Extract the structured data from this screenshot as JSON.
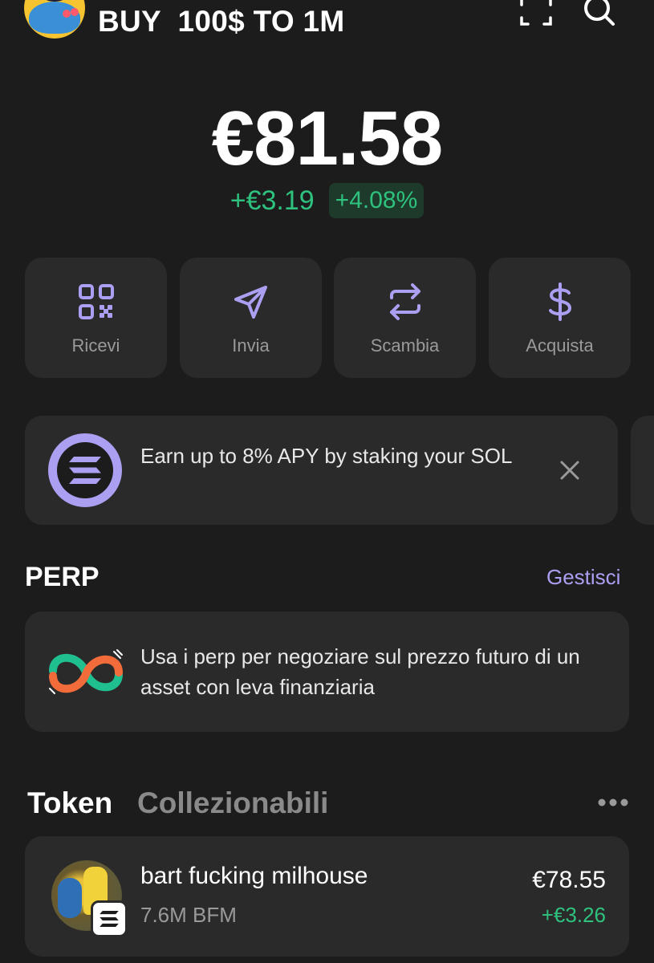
{
  "header": {
    "wallet_name": "BUY  100$ TO 1M",
    "icons": [
      "avatar",
      "scan-icon",
      "search-icon"
    ]
  },
  "balance": {
    "total": "€81.58",
    "change_abs": "+€3.19",
    "change_pct": "+4.08%"
  },
  "actions": [
    {
      "label": "Ricevi",
      "icon": "qr-code-icon"
    },
    {
      "label": "Invia",
      "icon": "send-icon"
    },
    {
      "label": "Scambia",
      "icon": "swap-icon"
    },
    {
      "label": "Acquista",
      "icon": "dollar-icon"
    }
  ],
  "banner": {
    "text": "Earn up to 8% APY by staking your SOL",
    "icon": "solana-icon"
  },
  "perp": {
    "title": "PERP",
    "manage": "Gestisci",
    "text": "Usa i perp per negoziare sul prezzo futuro di un asset con leva finanziaria"
  },
  "tabs": {
    "active": "Token",
    "inactive": "Collezionabili"
  },
  "tokens": [
    {
      "name": "bart fucking milhouse",
      "amount": "7.6M BFM",
      "value": "€78.55",
      "change": "+€3.26"
    }
  ],
  "colors": {
    "background": "#1c1c1c",
    "card": "#2a2a2a",
    "accent": "#ab9ff2",
    "positive": "#2ec27e"
  }
}
